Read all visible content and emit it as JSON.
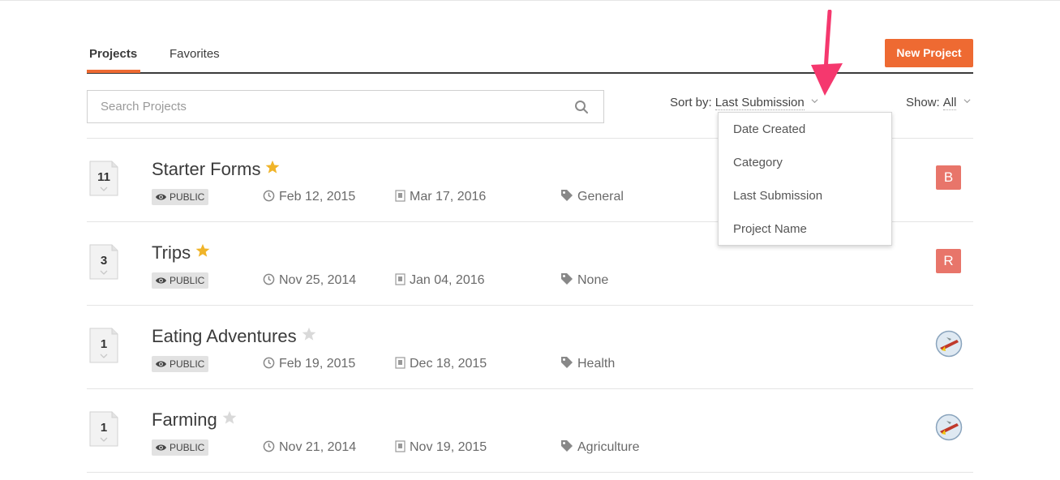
{
  "tabs": [
    {
      "label": "Projects",
      "active": true
    },
    {
      "label": "Favorites",
      "active": false
    }
  ],
  "toolbar": {
    "new_project_label": "New Project"
  },
  "search": {
    "placeholder": "Search Projects",
    "value": ""
  },
  "sort": {
    "label": "Sort by:",
    "value": "Last Submission",
    "options": [
      "Date Created",
      "Category",
      "Last Submission",
      "Project Name"
    ]
  },
  "show": {
    "label": "Show:",
    "value": "All"
  },
  "projects": [
    {
      "count": "11",
      "title": "Starter Forms",
      "favorite": true,
      "visibility": "PUBLIC",
      "created": "Feb 12, 2015",
      "last_submission": "Mar 17, 2016",
      "category": "General",
      "avatar_letter": "B"
    },
    {
      "count": "3",
      "title": "Trips",
      "favorite": true,
      "visibility": "PUBLIC",
      "created": "Nov 25, 2014",
      "last_submission": "Jan 04, 2016",
      "category": "None",
      "avatar_letter": "R"
    },
    {
      "count": "1",
      "title": "Eating Adventures",
      "favorite": false,
      "visibility": "PUBLIC",
      "created": "Feb 19, 2015",
      "last_submission": "Dec 18, 2015",
      "category": "Health",
      "avatar_letter": ""
    },
    {
      "count": "1",
      "title": "Farming",
      "favorite": false,
      "visibility": "PUBLIC",
      "created": "Nov 21, 2014",
      "last_submission": "Nov 19, 2015",
      "category": "Agriculture",
      "avatar_letter": ""
    }
  ],
  "colors": {
    "accent": "#ee6a32",
    "star_on": "#f0b429",
    "star_off": "#d9d9d9",
    "avatar": "#e8756a",
    "annotation_arrow": "#f5386e"
  },
  "icons": {
    "search": "search-icon",
    "star": "star-icon",
    "eye": "eye-icon",
    "clock": "clock-icon",
    "submission": "submission-icon",
    "tag": "tag-icon",
    "document": "document-icon",
    "chevron": "chevron-down-icon"
  }
}
